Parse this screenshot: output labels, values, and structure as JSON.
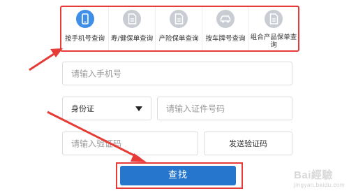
{
  "tabs": [
    {
      "label": "按手机号查询",
      "icon": "phone-icon",
      "active": true
    },
    {
      "label": "寿/健保单查询",
      "icon": "document-icon",
      "active": false
    },
    {
      "label": "产险保单查询",
      "icon": "document-icon",
      "active": false
    },
    {
      "label": "按车牌号查询",
      "icon": "car-icon",
      "active": false
    },
    {
      "label": "组合产品保单查询",
      "icon": "document-icon",
      "active": false
    }
  ],
  "form": {
    "phone_placeholder": "请输入手机号",
    "id_type": "身份证",
    "id_placeholder": "请输入证件号码",
    "code_placeholder": "请输入验证码",
    "send_code_label": "发送验证码",
    "submit_label": "查找"
  },
  "watermark": {
    "brand": "Bai經驗",
    "url": "jingyan.baidu.com"
  },
  "colors": {
    "accent": "#2576cc",
    "active_icon": "#3f8fe8",
    "inactive_icon": "#c9cdd3",
    "highlight": "#e63b36"
  }
}
